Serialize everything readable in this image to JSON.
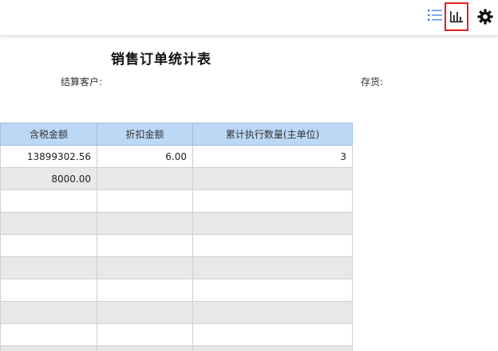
{
  "toolbar": {
    "list_icon": "list-icon",
    "chart_icon": "bar-chart-icon",
    "settings_icon": "gear-icon",
    "accent_color": "#3a7fe0",
    "highlight_color": "#e02020"
  },
  "report": {
    "title": "销售订单统计表",
    "filters": {
      "customer_label": "结算客户:",
      "inventory_label": "存货:"
    }
  },
  "table": {
    "header_color": "#bcd8f5",
    "alt_row_color": "#e8e8e8",
    "columns": [
      "含税金额",
      "折扣金额",
      "累计执行数量(主单位)"
    ],
    "rows": [
      [
        "13899302.56",
        "6.00",
        "3"
      ],
      [
        "8000.00",
        "",
        ""
      ],
      [
        "",
        "",
        ""
      ],
      [
        "",
        "",
        ""
      ],
      [
        "",
        "",
        ""
      ],
      [
        "",
        "",
        ""
      ],
      [
        "",
        "",
        ""
      ],
      [
        "",
        "",
        ""
      ],
      [
        "",
        "",
        ""
      ],
      [
        "",
        "",
        ""
      ]
    ]
  }
}
